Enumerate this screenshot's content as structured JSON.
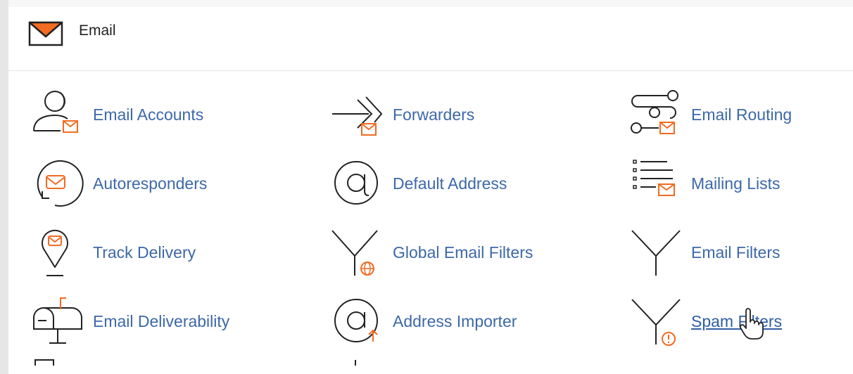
{
  "section": {
    "title": "Email",
    "icon": "envelope-icon"
  },
  "items": [
    {
      "label": "Email Accounts",
      "icon": "user-mail-icon"
    },
    {
      "label": "Forwarders",
      "icon": "forward-arrow-mail-icon"
    },
    {
      "label": "Email Routing",
      "icon": "routing-mail-icon"
    },
    {
      "label": "Autoresponders",
      "icon": "autoresponder-circle-icon"
    },
    {
      "label": "Default Address",
      "icon": "at-sign-icon"
    },
    {
      "label": "Mailing Lists",
      "icon": "list-mail-icon"
    },
    {
      "label": "Track Delivery",
      "icon": "location-pin-mail-icon"
    },
    {
      "label": "Global Email Filters",
      "icon": "funnel-globe-icon"
    },
    {
      "label": "Email Filters",
      "icon": "funnel-icon"
    },
    {
      "label": "Email Deliverability",
      "icon": "mailbox-icon"
    },
    {
      "label": "Address Importer",
      "icon": "at-sign-upload-icon"
    },
    {
      "label": "Spam Filters",
      "icon": "funnel-warning-icon"
    }
  ],
  "colors": {
    "link": "#3d68a8",
    "accent": "#f26b21",
    "icon_stroke": "#222222"
  }
}
